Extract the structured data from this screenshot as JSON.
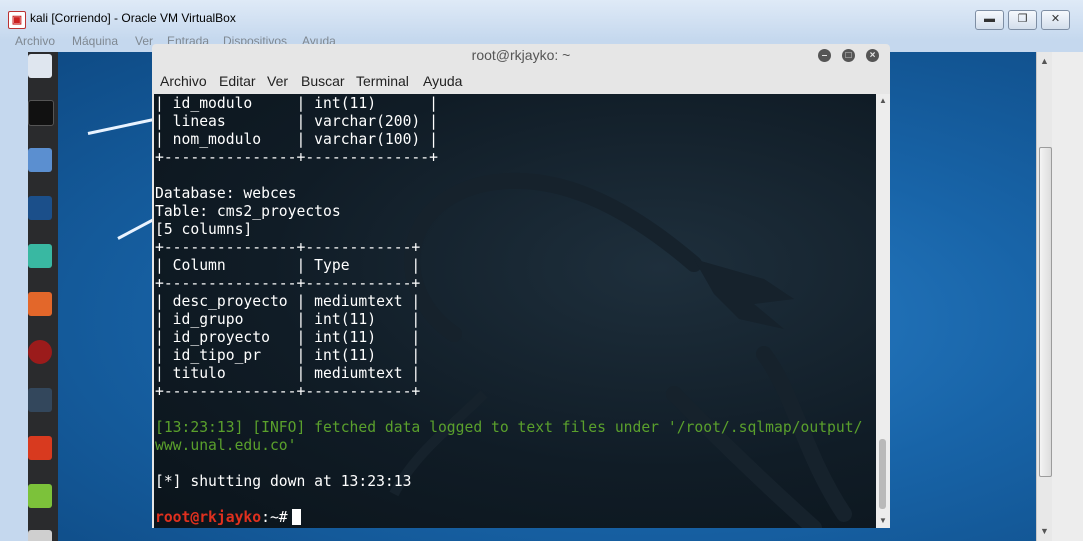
{
  "window": {
    "title": "kali [Corriendo] - Oracle VM VirtualBox",
    "controls": [
      "minimize",
      "maximize",
      "close"
    ]
  },
  "vbox_menu": [
    "Archivo",
    "Máquina",
    "Ver",
    "Entrada",
    "Dispositivos",
    "Ayuda"
  ],
  "dock": {
    "icons": [
      "kali-menu-icon",
      "terminal-icon",
      "files-icon",
      "metasploit-icon",
      "armitage-icon",
      "burpsuite-icon",
      "maltego-icon",
      "beef-icon",
      "faraday-icon",
      "leafpad-icon",
      "apps-icon"
    ]
  },
  "terminal": {
    "title": "root@rkjayko: ~",
    "menu": [
      "Archivo",
      "Editar",
      "Ver",
      "Buscar",
      "Terminal",
      "Ayuda"
    ],
    "lines": [
      {
        "text": "| id_modulo     | int(11)      |",
        "kind": "normal"
      },
      {
        "text": "| lineas        | varchar(200) |",
        "kind": "normal"
      },
      {
        "text": "| nom_modulo    | varchar(100) |",
        "kind": "normal"
      },
      {
        "text": "+---------------+--------------+",
        "kind": "normal"
      },
      {
        "text": "",
        "kind": "normal"
      },
      {
        "text": "Database: webces",
        "kind": "normal"
      },
      {
        "text": "Table: cms2_proyectos",
        "kind": "normal"
      },
      {
        "text": "[5 columns]",
        "kind": "normal"
      },
      {
        "text": "+---------------+------------+",
        "kind": "normal"
      },
      {
        "text": "| Column        | Type       |",
        "kind": "normal"
      },
      {
        "text": "+---------------+------------+",
        "kind": "normal"
      },
      {
        "text": "| desc_proyecto | mediumtext |",
        "kind": "normal"
      },
      {
        "text": "| id_grupo      | int(11)    |",
        "kind": "normal"
      },
      {
        "text": "| id_proyecto   | int(11)    |",
        "kind": "normal"
      },
      {
        "text": "| id_tipo_pr    | int(11)    |",
        "kind": "normal"
      },
      {
        "text": "| titulo        | mediumtext |",
        "kind": "normal"
      },
      {
        "text": "+---------------+------------+",
        "kind": "normal"
      },
      {
        "text": "",
        "kind": "normal"
      },
      {
        "text": "[13:23:13] [INFO] fetched data logged to text files under '/root/.sqlmap/output/",
        "kind": "info"
      },
      {
        "text": "www.unal.edu.co'",
        "kind": "info"
      },
      {
        "text": "",
        "kind": "normal"
      },
      {
        "text": "[*] shutting down at 13:23:13",
        "kind": "normal"
      },
      {
        "text": "",
        "kind": "normal"
      }
    ],
    "prompt": {
      "user": "root@rkjayko",
      "path": ":~#"
    }
  }
}
